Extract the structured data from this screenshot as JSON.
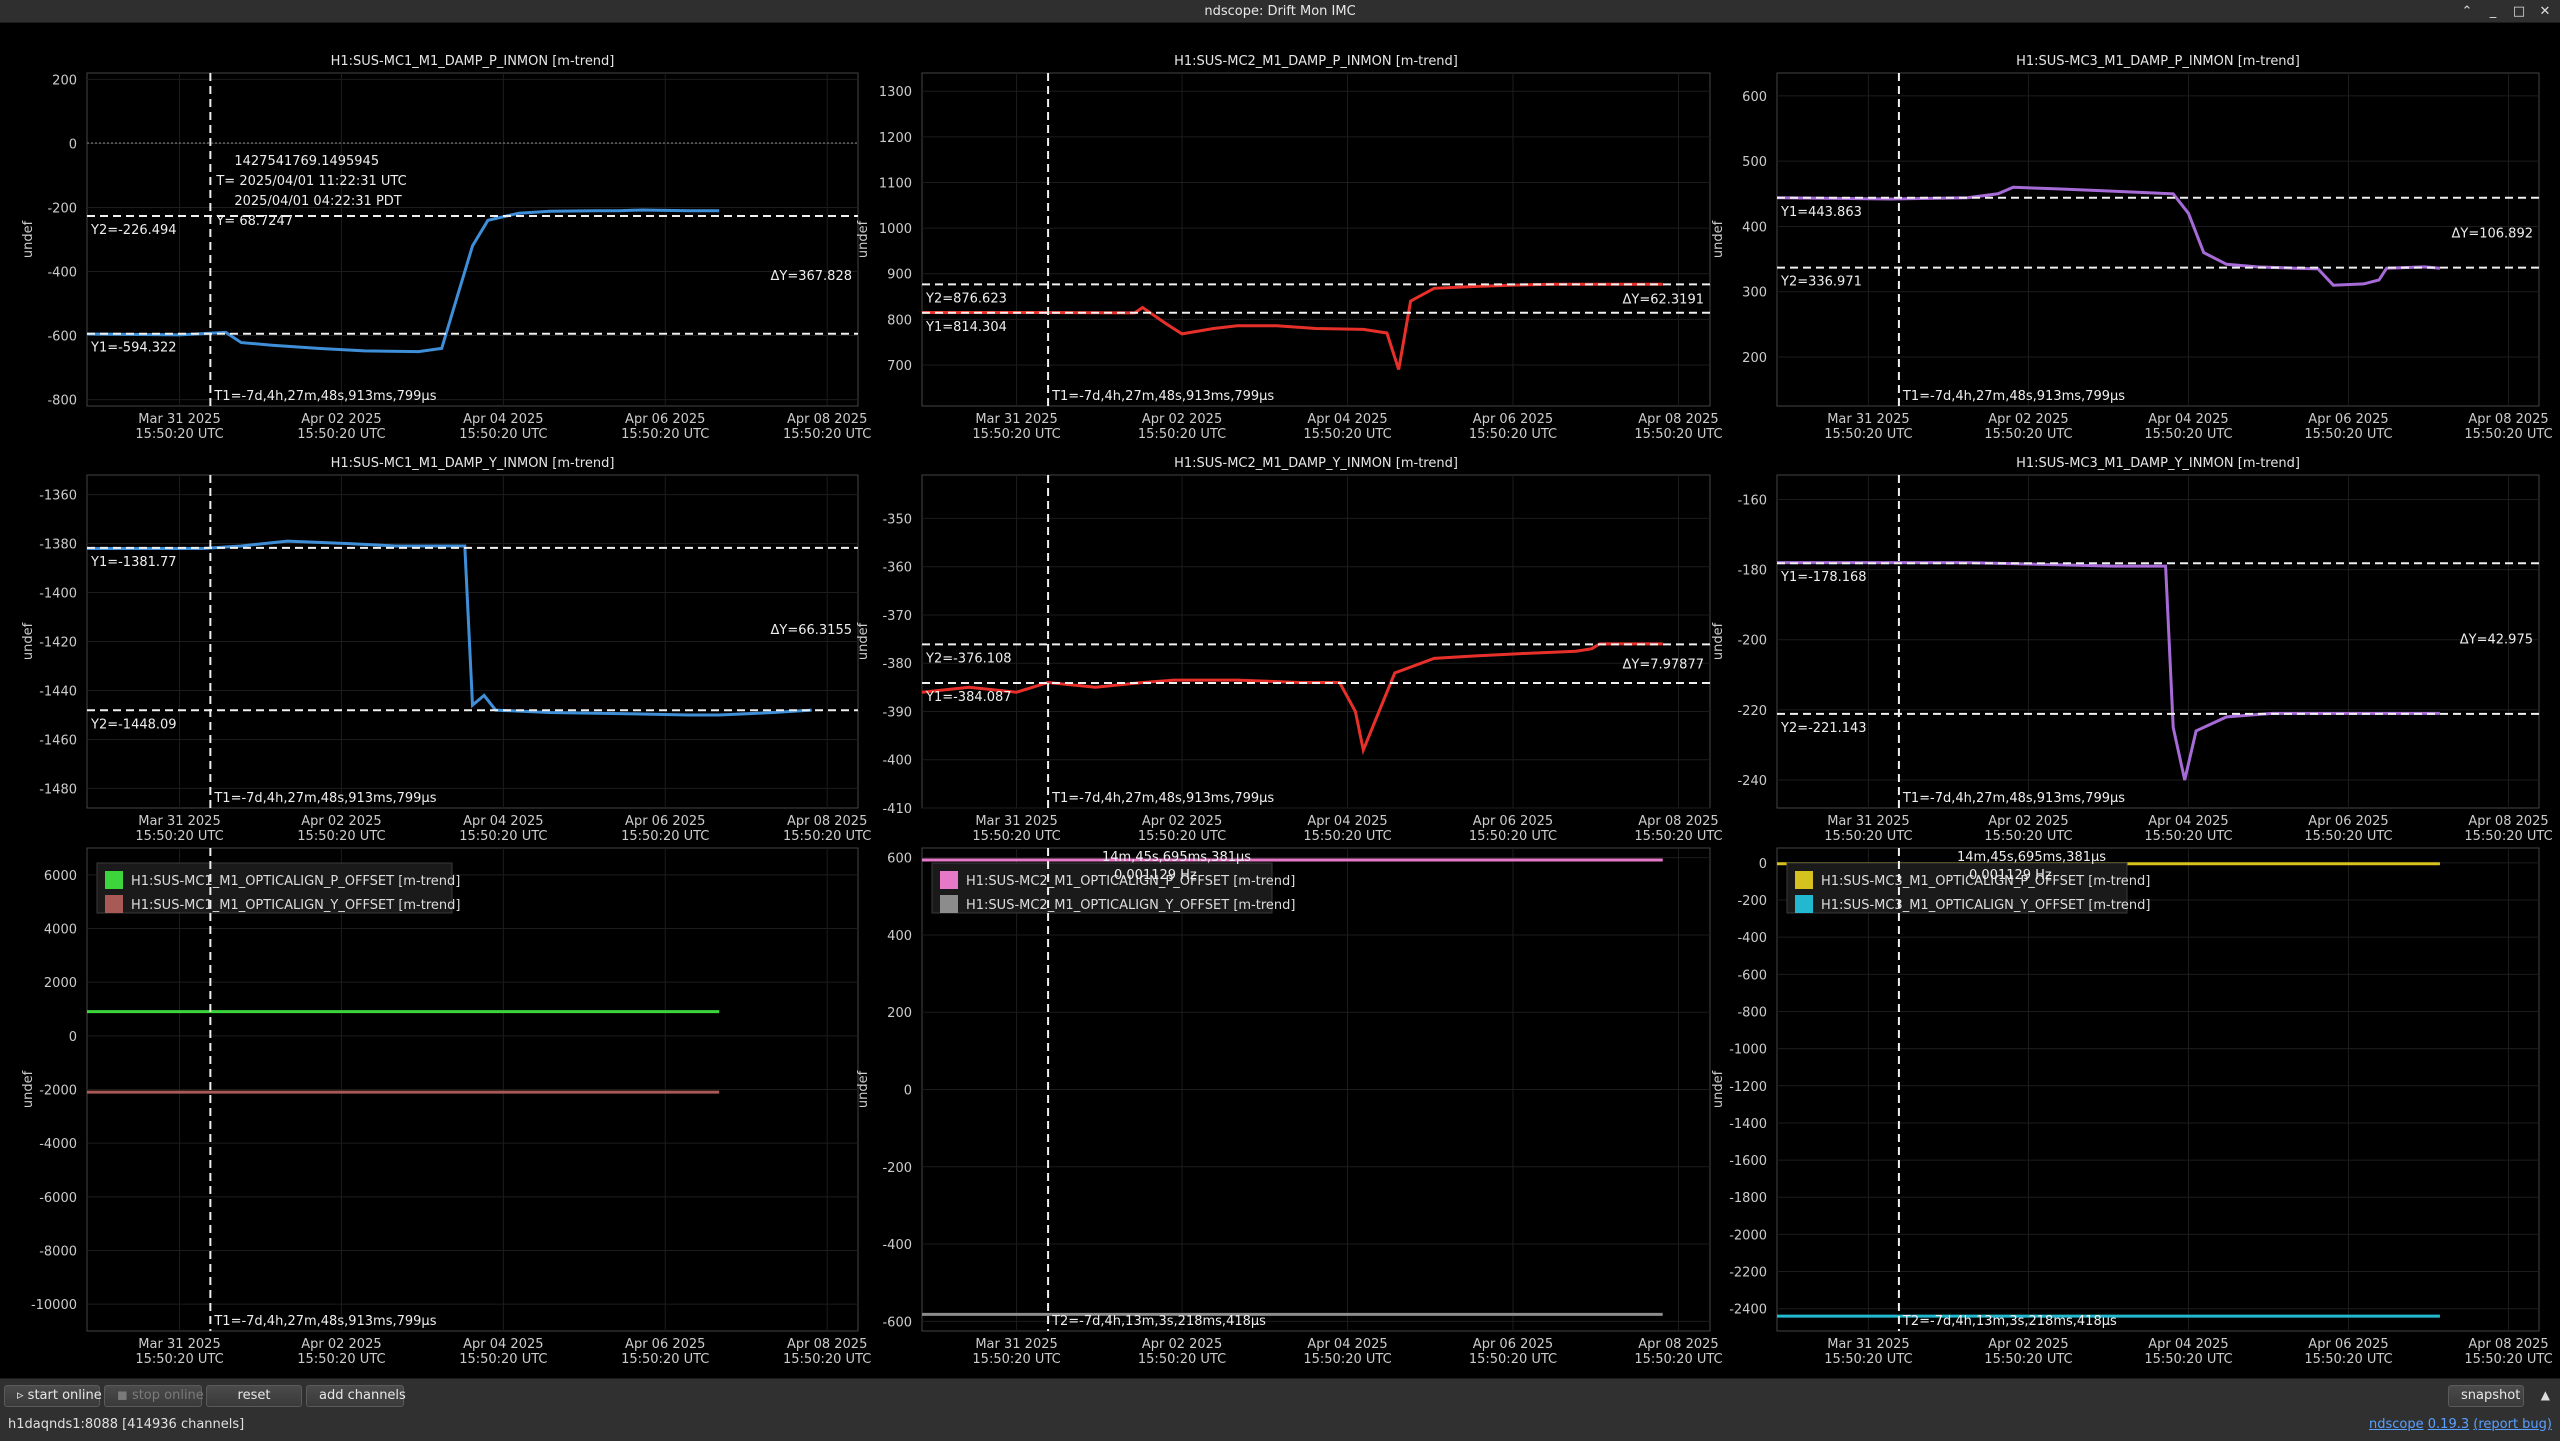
{
  "window": {
    "title": "ndscope: Drift Mon IMC"
  },
  "common": {
    "x_ticks": [
      "Mar 31 2025",
      "Apr 02 2025",
      "Apr 04 2025",
      "Apr 06 2025",
      "Apr 08 2025"
    ],
    "x_tick_sub": "15:50:20 UTC",
    "y_label": "undef"
  },
  "chart_data": [
    {
      "type": "line",
      "title": "H1:SUS-MC1_M1_DAMP_P_INMON [m-trend]",
      "color": "#3f8fd8",
      "ylim": [
        -820,
        220
      ],
      "yticks": [
        200,
        0,
        -200,
        -400,
        -600,
        -800
      ],
      "cursor_y1": {
        "label": "Y1=-594.322",
        "value": -594.322
      },
      "cursor_y2": {
        "label": "Y2=-226.494",
        "value": -226.494
      },
      "delta_y": "ΔY=367.828",
      "cursor_t": "T1=-7d,4h,27m,48s,913ms,799μs",
      "readout": [
        "1427541769.1495945",
        "T= 2025/04/01 11:22:31 UTC",
        "2025/04/01 04:22:31 PDT",
        "Y= 68.7247"
      ],
      "points": [
        [
          0,
          -595
        ],
        [
          1.2,
          -598
        ],
        [
          1.8,
          -590
        ],
        [
          2.0,
          -622
        ],
        [
          2.4,
          -630
        ],
        [
          3.0,
          -640
        ],
        [
          3.6,
          -648
        ],
        [
          4.3,
          -650
        ],
        [
          4.6,
          -640
        ],
        [
          4.8,
          -480
        ],
        [
          5.0,
          -320
        ],
        [
          5.2,
          -240
        ],
        [
          5.6,
          -218
        ],
        [
          6.0,
          -212
        ],
        [
          6.6,
          -210
        ],
        [
          6.9,
          -210
        ],
        [
          7.2,
          -208
        ],
        [
          7.8,
          -210
        ],
        [
          8.2,
          -210
        ]
      ],
      "line_end": 8.2
    },
    {
      "type": "line",
      "title": "H1:SUS-MC2_M1_DAMP_P_INMON [m-trend]",
      "color": "#e8302a",
      "ylim": [
        610,
        1340
      ],
      "yticks": [
        1300,
        1200,
        1100,
        1000,
        900,
        800,
        700
      ],
      "cursor_y1": {
        "label": "Y1=814.304",
        "value": 814.304
      },
      "cursor_y2": {
        "label": "Y2=876.623",
        "value": 876.623
      },
      "delta_y": "ΔY=62.3191",
      "cursor_t": "T1=-7d,4h,27m,48s,913ms,799μs",
      "points": [
        [
          0,
          815
        ],
        [
          1.5,
          815
        ],
        [
          2.7,
          814
        ],
        [
          2.8,
          826
        ],
        [
          3.1,
          790
        ],
        [
          3.3,
          768
        ],
        [
          3.7,
          780
        ],
        [
          4.0,
          786
        ],
        [
          4.5,
          786
        ],
        [
          5.0,
          780
        ],
        [
          5.6,
          778
        ],
        [
          5.9,
          770
        ],
        [
          6.05,
          690
        ],
        [
          6.2,
          840
        ],
        [
          6.5,
          868
        ],
        [
          7.0,
          872
        ],
        [
          7.5,
          875
        ],
        [
          8.0,
          877
        ],
        [
          8.7,
          877
        ],
        [
          9.0,
          877
        ],
        [
          9.4,
          877
        ]
      ],
      "line_end": 9.4
    },
    {
      "type": "line",
      "title": "H1:SUS-MC3_M1_DAMP_P_INMON [m-trend]",
      "color": "#a66bd6",
      "ylim": [
        125,
        635
      ],
      "yticks": [
        600,
        500,
        400,
        300,
        200
      ],
      "cursor_y1": {
        "label": "Y1=443.863",
        "value": 443.863
      },
      "cursor_y2": {
        "label": "Y2=336.971",
        "value": 336.971
      },
      "delta_y": "ΔY=106.892",
      "cursor_t": "T1=-7d,4h,27m,48s,913ms,799μs",
      "points": [
        [
          0,
          444
        ],
        [
          1.5,
          442
        ],
        [
          2.5,
          444
        ],
        [
          2.9,
          450
        ],
        [
          3.1,
          460
        ],
        [
          3.6,
          458
        ],
        [
          4.2,
          455
        ],
        [
          4.8,
          452
        ],
        [
          5.2,
          450
        ],
        [
          5.4,
          420
        ],
        [
          5.6,
          360
        ],
        [
          5.9,
          342
        ],
        [
          6.3,
          338
        ],
        [
          6.8,
          336
        ],
        [
          7.1,
          335
        ],
        [
          7.3,
          310
        ],
        [
          7.7,
          312
        ],
        [
          7.9,
          318
        ],
        [
          8.0,
          336
        ],
        [
          8.5,
          338
        ],
        [
          8.7,
          336
        ]
      ],
      "line_end": 8.7
    },
    {
      "type": "line",
      "title": "H1:SUS-MC1_M1_DAMP_Y_INMON [m-trend]",
      "color": "#3f8fd8",
      "ylim": [
        -1488,
        -1352
      ],
      "yticks": [
        -1360,
        -1380,
        -1400,
        -1420,
        -1440,
        -1460,
        -1480
      ],
      "cursor_y1": {
        "label": "Y1=-1381.77",
        "value": -1381.77
      },
      "cursor_y2": {
        "label": "Y2=-1448.09",
        "value": -1448.09
      },
      "delta_y": "ΔY=66.3155",
      "cursor_t": "T1=-7d,4h,27m,48s,913ms,799μs",
      "points": [
        [
          0,
          -1382
        ],
        [
          1.5,
          -1382
        ],
        [
          2.0,
          -1381
        ],
        [
          2.6,
          -1379
        ],
        [
          3.4,
          -1380
        ],
        [
          4.0,
          -1381
        ],
        [
          4.9,
          -1381
        ],
        [
          5.0,
          -1446
        ],
        [
          5.15,
          -1442
        ],
        [
          5.3,
          -1448
        ],
        [
          6.0,
          -1449
        ],
        [
          7.0,
          -1449.5
        ],
        [
          7.8,
          -1450
        ],
        [
          8.2,
          -1450
        ],
        [
          8.9,
          -1449
        ],
        [
          9.4,
          -1448
        ]
      ],
      "line_end": 9.4
    },
    {
      "type": "line",
      "title": "H1:SUS-MC2_M1_DAMP_Y_INMON [m-trend]",
      "color": "#e8302a",
      "ylim": [
        -410,
        -341
      ],
      "yticks": [
        -350,
        -360,
        -370,
        -380,
        -390,
        -400,
        -410
      ],
      "cursor_y1": {
        "label": "Y1=-384.087",
        "value": -384.087
      },
      "cursor_y2": {
        "label": "Y2=-376.108",
        "value": -376.108
      },
      "delta_y": "ΔY=7.97877",
      "cursor_t": "T1=-7d,4h,27m,48s,913ms,799μs",
      "points": [
        [
          0,
          -386
        ],
        [
          0.6,
          -385
        ],
        [
          1.2,
          -386
        ],
        [
          1.6,
          -384
        ],
        [
          2.2,
          -385
        ],
        [
          2.8,
          -384
        ],
        [
          3.2,
          -383.5
        ],
        [
          4.0,
          -383.5
        ],
        [
          4.8,
          -384
        ],
        [
          5.3,
          -384
        ],
        [
          5.5,
          -390
        ],
        [
          5.6,
          -398
        ],
        [
          5.8,
          -390
        ],
        [
          6.0,
          -382
        ],
        [
          6.5,
          -379
        ],
        [
          7.0,
          -378.5
        ],
        [
          7.6,
          -378
        ],
        [
          8.3,
          -377.5
        ],
        [
          8.5,
          -377
        ],
        [
          8.6,
          -376
        ],
        [
          9.0,
          -376
        ],
        [
          9.4,
          -376
        ]
      ],
      "line_end": 9.4
    },
    {
      "type": "line",
      "title": "H1:SUS-MC3_M1_DAMP_Y_INMON [m-trend]",
      "color": "#a66bd6",
      "ylim": [
        -248,
        -153
      ],
      "yticks": [
        -160,
        -180,
        -200,
        -220,
        -240
      ],
      "cursor_y1": {
        "label": "Y1=-178.168",
        "value": -178.168
      },
      "cursor_y2": {
        "label": "Y2=-221.143",
        "value": -221.143
      },
      "delta_y": "ΔY=42.975",
      "cursor_t": "T1=-7d,4h,27m,48s,913ms,799μs",
      "points": [
        [
          0,
          -178
        ],
        [
          1.5,
          -178
        ],
        [
          2.5,
          -178
        ],
        [
          3.5,
          -178.5
        ],
        [
          4.4,
          -179
        ],
        [
          5.1,
          -179
        ],
        [
          5.2,
          -225
        ],
        [
          5.35,
          -240
        ],
        [
          5.5,
          -226
        ],
        [
          5.9,
          -222
        ],
        [
          6.5,
          -221
        ],
        [
          7.2,
          -221
        ],
        [
          7.8,
          -221
        ],
        [
          8.1,
          -221
        ],
        [
          8.5,
          -221
        ],
        [
          8.7,
          -221
        ]
      ],
      "line_end": 8.7
    },
    {
      "type": "line",
      "title": "",
      "ylim": [
        -11000,
        7000
      ],
      "yticks": [
        6000,
        4000,
        2000,
        0,
        -2000,
        -4000,
        -6000,
        -8000,
        -10000
      ],
      "cursor_t": "T1=-7d,4h,27m,48s,913ms,799μs",
      "series": [
        {
          "name": "H1:SUS-MC1_M1_OPTICALIGN_P_OFFSET [m-trend]",
          "color": "#3cd63c",
          "value": 900
        },
        {
          "name": "H1:SUS-MC1_M1_OPTICALIGN_Y_OFFSET [m-trend]",
          "color": "#a85b56",
          "value": -2100
        }
      ],
      "line_end": 8.2
    },
    {
      "type": "line",
      "title": "",
      "ylim": [
        -625,
        625
      ],
      "yticks": [
        600,
        400,
        200,
        0,
        -200,
        -400,
        -600
      ],
      "cursor_t": "T2=-7d,4h,13m,3s,218ms,418μs",
      "top_readout": [
        "14m,45s,695ms,381μs",
        "0.001129 Hz"
      ],
      "series": [
        {
          "name": "H1:SUS-MC2_M1_OPTICALIGN_P_OFFSET [m-trend]",
          "color": "#e678c8",
          "value": 594
        },
        {
          "name": "H1:SUS-MC2_M1_OPTICALIGN_Y_OFFSET [m-trend]",
          "color": "#8c8c8c",
          "value": -582
        }
      ],
      "line_end": 9.4
    },
    {
      "type": "line",
      "title": "",
      "ylim": [
        -2520,
        80
      ],
      "yticks": [
        0,
        -200,
        -400,
        -600,
        -800,
        -1000,
        -1200,
        -1400,
        -1600,
        -1800,
        -2000,
        -2200,
        -2400
      ],
      "cursor_t": "T2=-7d,4h,13m,3s,218ms,418μs",
      "top_readout": [
        "14m,45s,695ms,381μs",
        "0.001129 Hz"
      ],
      "series": [
        {
          "name": "H1:SUS-MC3_M1_OPTICALIGN_P_OFFSET [m-trend]",
          "color": "#d6c21f",
          "value": -5
        },
        {
          "name": "H1:SUS-MC3_M1_OPTICALIGN_Y_OFFSET [m-trend]",
          "color": "#22b8d0",
          "value": -2440
        }
      ],
      "line_end": 8.7
    }
  ],
  "toolbar": {
    "start_online": "start online",
    "stop_online": "stop online",
    "reset": "reset",
    "add_channels": "add channels",
    "snapshot": "snapshot"
  },
  "status": {
    "server": "h1daqnds1:8088  [414936 channels]",
    "version_prefix": "ndscope",
    "version": "0.19.3",
    "report": "(report bug)"
  }
}
